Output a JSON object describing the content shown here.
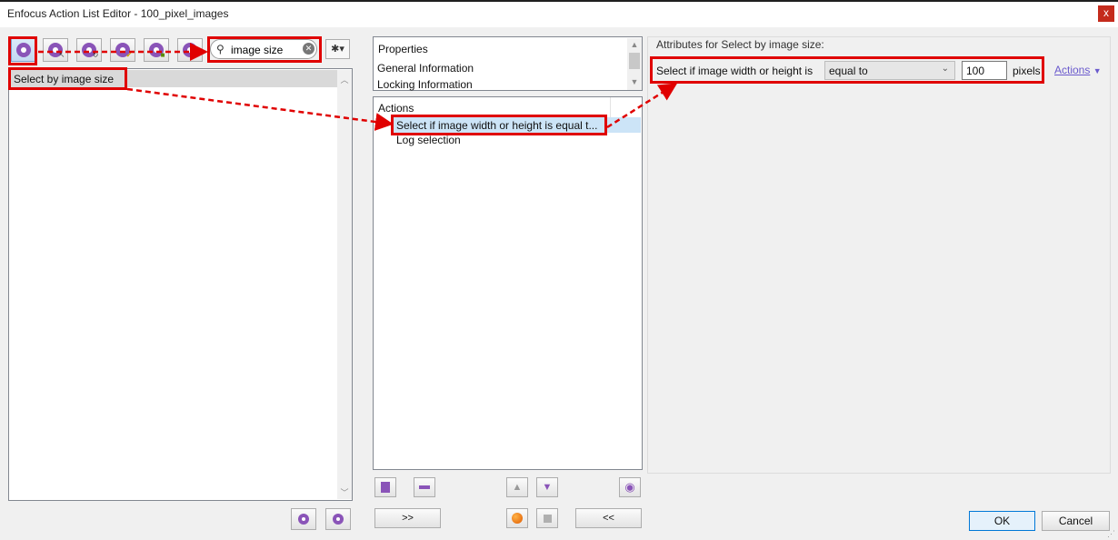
{
  "window": {
    "title": "Enfocus Action List Editor - 100_pixel_images",
    "close_label": "x"
  },
  "toolbar": {
    "icons": [
      "gear-icon",
      "gear-cursor-icon",
      "gear-refresh-icon",
      "gear-check-icon",
      "gear-lock-icon",
      "gear-edit-icon"
    ],
    "search_value": "image size",
    "options_label": "✱▾"
  },
  "left_list": {
    "items": [
      "Select by image size"
    ]
  },
  "properties": {
    "header": "Properties",
    "items": [
      "General Information",
      "Locking Information"
    ]
  },
  "actions": {
    "header": "Actions",
    "items": [
      "Select if image width or height is equal t...",
      "Log selection"
    ]
  },
  "attributes": {
    "title": "Attributes for Select by image size:",
    "label": "Select if image width or height is",
    "operator": "equal to",
    "value": "100",
    "unit": "pixels",
    "actions_link": "Actions"
  },
  "buttons": {
    "forward": ">>",
    "back": "<<",
    "ok": "OK",
    "cancel": "Cancel"
  },
  "colors": {
    "highlight": "#e00000",
    "gear": "#8a54b8",
    "selection": "#cce4f7"
  }
}
